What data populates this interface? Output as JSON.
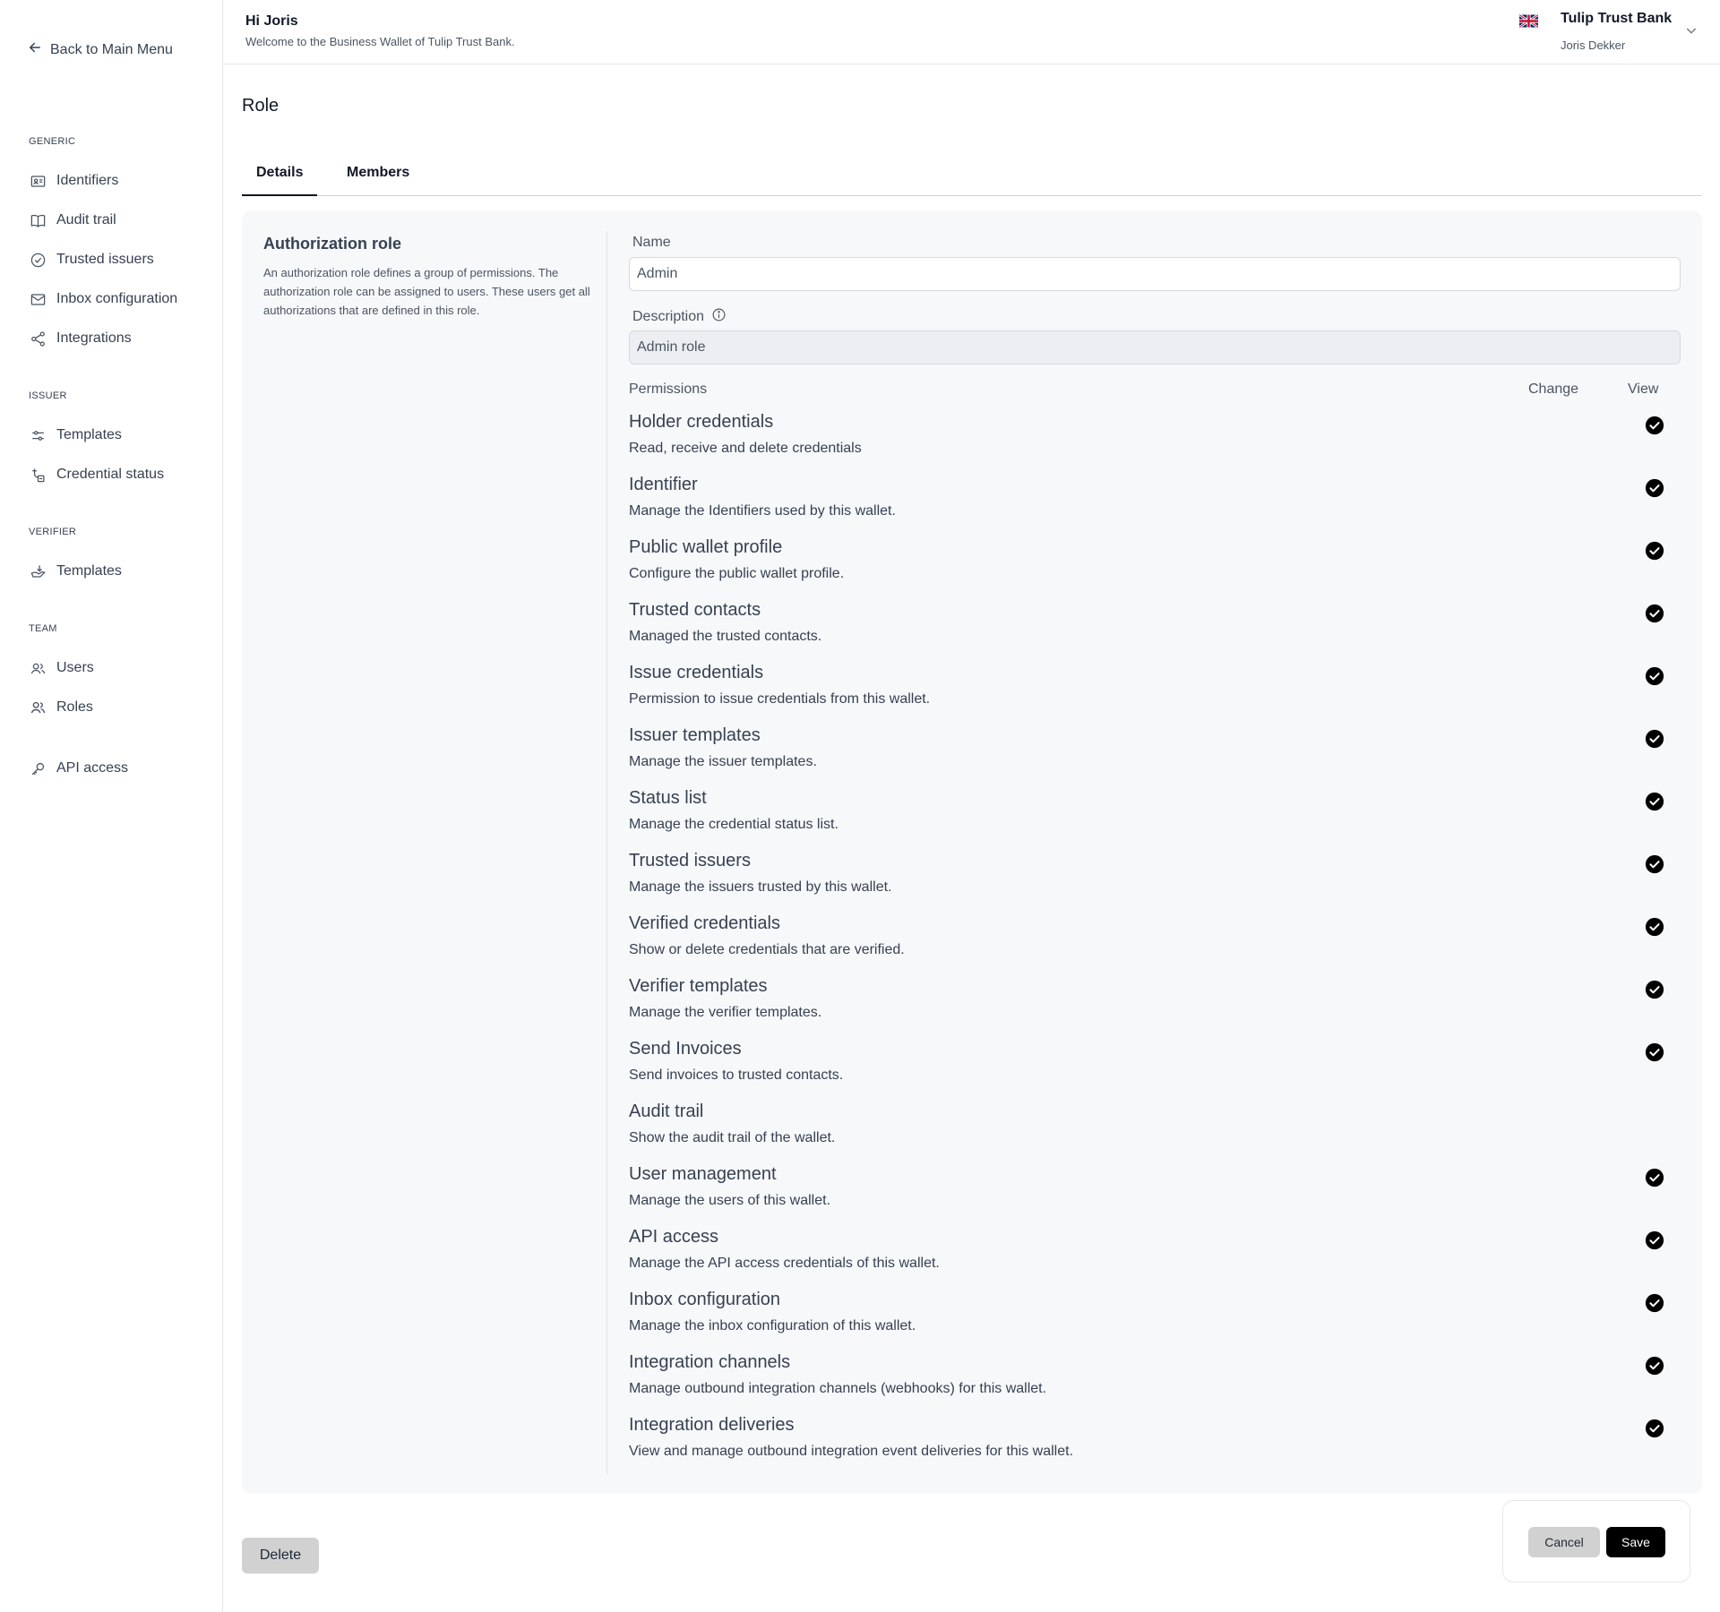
{
  "sidebar": {
    "back_label": "Back to Main Menu",
    "sections": {
      "generic": "GENERIC",
      "issuer": "ISSUER",
      "verifier": "VERIFIER",
      "team": "TEAM"
    },
    "items": [
      {
        "label": "Identifiers",
        "icon": "id-card-icon"
      },
      {
        "label": "Audit trail",
        "icon": "book-open-icon"
      },
      {
        "label": "Trusted issuers",
        "icon": "check-circle-icon"
      },
      {
        "label": "Inbox configuration",
        "icon": "mail-icon"
      },
      {
        "label": "Integrations",
        "icon": "share-icon"
      },
      {
        "label": "Templates",
        "icon": "sliders-icon"
      },
      {
        "label": "Credential status",
        "icon": "credential-status-icon"
      },
      {
        "label": "Templates",
        "icon": "inbox-download-icon"
      },
      {
        "label": "Users",
        "icon": "users-icon"
      },
      {
        "label": "Roles",
        "icon": "user-group-icon"
      },
      {
        "label": "API access",
        "icon": "key-icon"
      }
    ]
  },
  "header": {
    "greeting": "Hi Joris",
    "welcome": "Welcome to the Business Wallet of Tulip Trust Bank.",
    "org_name": "Tulip Trust Bank",
    "user_name": "Joris Dekker",
    "flag_icon": "uk-flag-icon",
    "chevron_icon": "chevron-down-icon"
  },
  "page": {
    "title": "Role",
    "tabs": [
      "Details",
      "Members"
    ],
    "active_tab": "Details"
  },
  "role_card": {
    "title": "Authorization role",
    "description": "An authorization role defines a group of permissions. The authorization role can be assigned to users. These users get all authorizations that are defined in this role.",
    "name_label": "Name",
    "name_value": "Admin",
    "description_label": "Description",
    "description_value": "Admin role",
    "permissions_label": "Permissions",
    "change_label": "Change",
    "view_label": "View"
  },
  "permissions": [
    {
      "name": "Holder credentials",
      "desc": "Read, receive and delete credentials",
      "change": "checked",
      "view": "checked-locked"
    },
    {
      "name": "Identifier",
      "desc": "Manage the Identifiers used by this wallet.",
      "change": "checked",
      "view": "checked-locked"
    },
    {
      "name": "Public wallet profile",
      "desc": "Configure the public wallet profile.",
      "change": "checked",
      "view": "checked-locked"
    },
    {
      "name": "Trusted contacts",
      "desc": "Managed the trusted contacts.",
      "change": "checked",
      "view": "checked-locked"
    },
    {
      "name": "Issue credentials",
      "desc": "Permission to issue credentials from this wallet.",
      "change": "checked",
      "view": "checked-locked"
    },
    {
      "name": "Issuer templates",
      "desc": "Manage the issuer templates.",
      "change": "checked",
      "view": "checked-locked"
    },
    {
      "name": "Status list",
      "desc": "Manage the credential status list.",
      "change": "checked",
      "view": "checked-locked"
    },
    {
      "name": "Trusted issuers",
      "desc": "Manage the issuers trusted by this wallet.",
      "change": "checked",
      "view": "checked-locked"
    },
    {
      "name": "Verified credentials",
      "desc": "Show or delete credentials that are verified.",
      "change": "checked",
      "view": "checked-locked"
    },
    {
      "name": "Verifier templates",
      "desc": "Manage the verifier templates.",
      "change": "checked",
      "view": "checked-locked"
    },
    {
      "name": "Send Invoices",
      "desc": "Send invoices to trusted contacts.",
      "change": "checked",
      "view": "none"
    },
    {
      "name": "Audit trail",
      "desc": "Show the audit trail of the wallet.",
      "change": "none",
      "view": "checked"
    },
    {
      "name": "User management",
      "desc": "Manage the users of this wallet.",
      "change": "checked",
      "view": "checked-locked"
    },
    {
      "name": "API access",
      "desc": "Manage the API access credentials of this wallet.",
      "change": "checked",
      "view": "checked-locked"
    },
    {
      "name": "Inbox configuration",
      "desc": "Manage the inbox configuration of this wallet.",
      "change": "checked",
      "view": "checked-locked"
    },
    {
      "name": "Integration channels",
      "desc": "Manage outbound integration channels (webhooks) for this wallet.",
      "change": "checked",
      "view": "checked-locked"
    },
    {
      "name": "Integration deliveries",
      "desc": "View and manage outbound integration event deliveries for this wallet.",
      "change": "checked",
      "view": "checked-locked"
    }
  ],
  "actions": {
    "delete": "Delete",
    "cancel": "Cancel",
    "save": "Save"
  },
  "colors": {
    "check_active": "#000000",
    "check_locked": "#555555",
    "card_bg": "#f7f8fa"
  }
}
